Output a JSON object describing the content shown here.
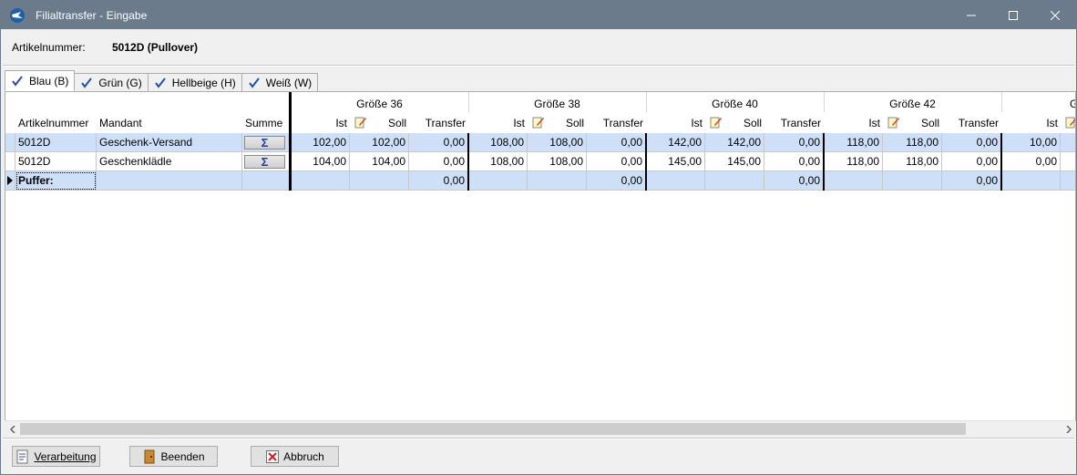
{
  "window": {
    "title": "Filialtransfer - Eingabe"
  },
  "header": {
    "label": "Artikelnummer:",
    "value": "5012D (Pullover)"
  },
  "tabs": [
    {
      "label": "Blau (B)",
      "active": true
    },
    {
      "label": "Grün (G)",
      "active": false
    },
    {
      "label": "Hellbeige (H)",
      "active": false
    },
    {
      "label": "Weiß (W)",
      "active": false
    }
  ],
  "grid": {
    "fixed_headers": {
      "artikel": "Artikelnummer",
      "mandant": "Mandant",
      "summe": "Summe"
    },
    "size_groups": [
      {
        "label": "Größe 36"
      },
      {
        "label": "Größe 38"
      },
      {
        "label": "Größe 40"
      },
      {
        "label": "Größe 42"
      },
      {
        "label": "G"
      }
    ],
    "sub_headers": {
      "ist": "Ist",
      "soll": "Soll",
      "transfer": "Transfer"
    },
    "summe_symbol": "Σ",
    "rows": [
      {
        "artikel": "5012D",
        "mandant": "Geschenk-Versand",
        "g36": {
          "ist": "102,00",
          "soll": "102,00",
          "transfer": "0,00"
        },
        "g38": {
          "ist": "108,00",
          "soll": "108,00",
          "transfer": "0,00"
        },
        "g40": {
          "ist": "142,00",
          "soll": "142,00",
          "transfer": "0,00"
        },
        "g42": {
          "ist": "118,00",
          "soll": "118,00",
          "transfer": "0,00"
        },
        "g44": {
          "ist": "10,00"
        }
      },
      {
        "artikel": "5012D",
        "mandant": "Geschenklädle",
        "g36": {
          "ist": "104,00",
          "soll": "104,00",
          "transfer": "0,00"
        },
        "g38": {
          "ist": "108,00",
          "soll": "108,00",
          "transfer": "0,00"
        },
        "g40": {
          "ist": "145,00",
          "soll": "145,00",
          "transfer": "0,00"
        },
        "g42": {
          "ist": "118,00",
          "soll": "118,00",
          "transfer": "0,00"
        },
        "g44": {
          "ist": "0,00"
        }
      }
    ],
    "buffer": {
      "label": "Puffer:",
      "g36": "0,00",
      "g38": "0,00",
      "g40": "0,00",
      "g42": "0,00"
    }
  },
  "buttons": {
    "verarbeitung": "Verarbeitung",
    "beenden": "Beenden",
    "abbruch": "Abbruch"
  }
}
